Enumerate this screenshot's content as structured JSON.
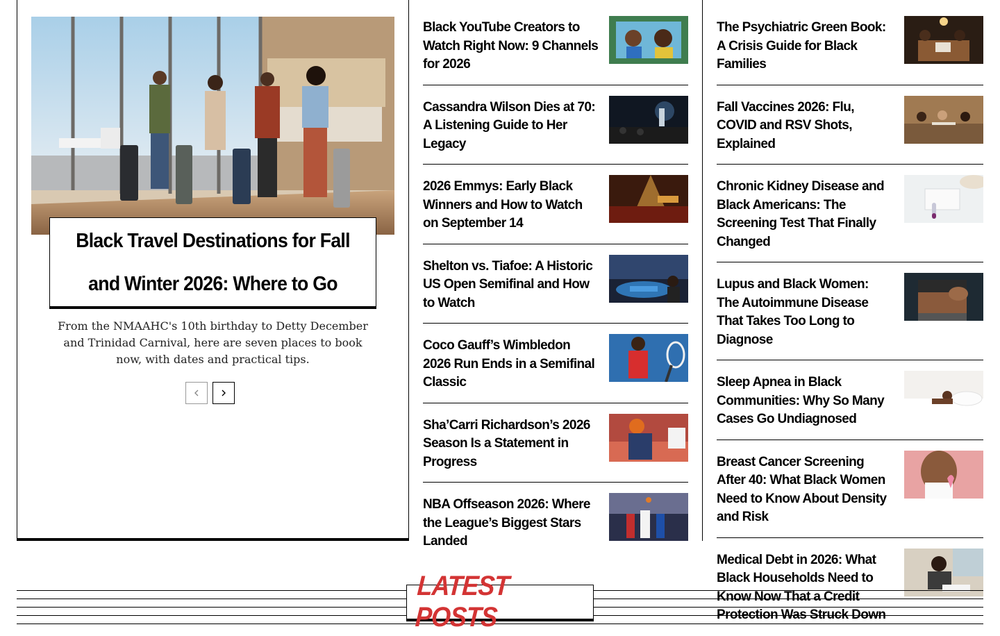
{
  "featured": {
    "title": "Black Travel Destinations for Fall and Winter 2026: Where to Go",
    "excerpt": "From the NMAAHC's 10th birthday to Detty December and Trinidad Carnival, here are seven places to book now, with dates and practical tips.",
    "prev_icon": "chevron-left-icon",
    "next_icon": "chevron-right-icon"
  },
  "middle_column": [
    {
      "title": "Black YouTube Creators to Watch Right Now: 9 Channels for 2026",
      "thumb": "creators"
    },
    {
      "title": "Cassandra Wilson Dies at 70: A Listening Guide to Her Legacy",
      "thumb": "stage"
    },
    {
      "title": "2026 Emmys: Early Black Winners and How to Watch on September 14",
      "thumb": "theater"
    },
    {
      "title": "Shelton vs. Tiafoe: A Historic US Open Semifinal and How to Watch",
      "thumb": "stadium"
    },
    {
      "title": "Coco Gauff’s Wimbledon 2026 Run Ends in a Semifinal Classic",
      "thumb": "tennis"
    },
    {
      "title": "Sha’Carri Richardson’s 2026 Season Is a Statement in Progress",
      "thumb": "sprinter"
    },
    {
      "title": "NBA Offseason 2026: Where the League’s Biggest Stars Landed",
      "thumb": "basketball"
    }
  ],
  "right_column": [
    {
      "title": "The Psychiatric Green Book: A Crisis Guide for Black Families",
      "thumb": "family"
    },
    {
      "title": "Fall Vaccines 2026: Flu, COVID and RSV Shots, Explained",
      "thumb": "clinic"
    },
    {
      "title": "Chronic Kidney Disease and Black Americans: The Screening Test That Finally Changed",
      "thumb": "test"
    },
    {
      "title": "Lupus and Black Women: The Autoimmune Disease That Takes Too Long to Diagnose",
      "thumb": "back"
    },
    {
      "title": "Sleep Apnea in Black Communities: Why So Many Cases Go Undiagnosed",
      "thumb": "sleep"
    },
    {
      "title": "Breast Cancer Screening After 40: What Black Women Need to Know About Density and Risk",
      "thumb": "ribbon"
    },
    {
      "title": "Medical Debt in 2026: What Black Households Need to Know Now That a Credit Protection Was Struck Down",
      "thumb": "debt"
    }
  ],
  "latest": {
    "label": "LATEST POSTS"
  },
  "colors": {
    "accent": "#d33434"
  }
}
